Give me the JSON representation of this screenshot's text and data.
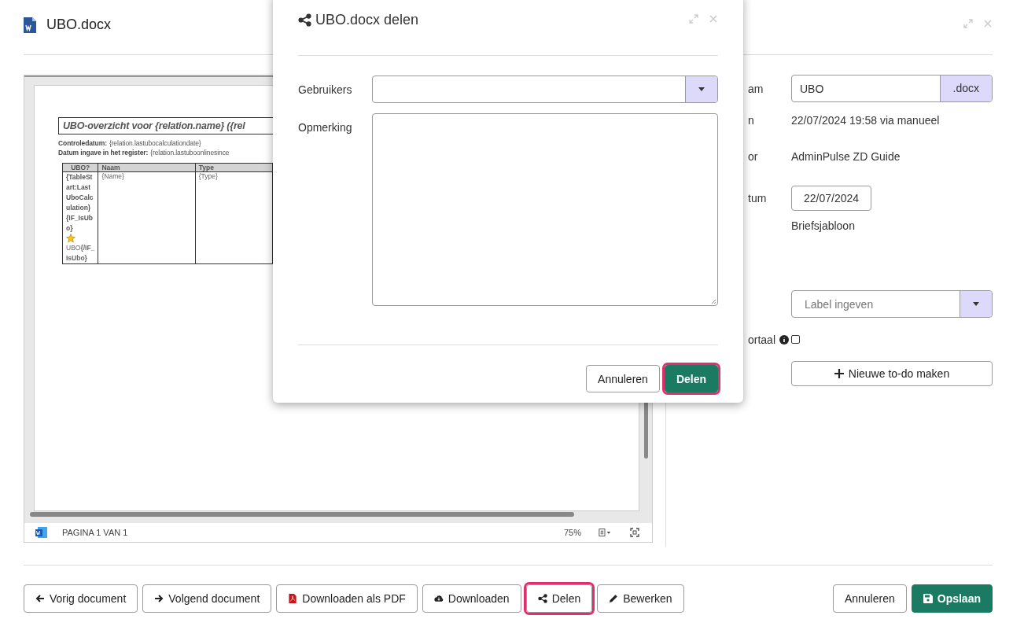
{
  "window": {
    "title": "UBO.docx"
  },
  "document_viewer": {
    "heading": "UBO-overzicht  voor {relation.name}  ({rel",
    "lines": [
      {
        "label": "Controledatum:",
        "value": "{relation.lastubocalculationdate}"
      },
      {
        "label": "Datum ingave in het register:",
        "value": "{relation.lastuboonlinesince"
      }
    ],
    "table": {
      "columns": [
        "UBO?",
        "Naam",
        "Type"
      ],
      "rows": [
        {
          "cells": [
            "{TableStart:LastUboCalculation}{IF_IsUbo}",
            "{Name}",
            "{Type}"
          ],
          "after_icon": "UBO**{/IF_IsUbo}**"
        }
      ]
    },
    "status_bar": {
      "page": "PAGINA 1 VAN 1",
      "zoom": "75%"
    }
  },
  "details": [
    {
      "label": "am",
      "kind": "input",
      "value": "UBO",
      "suffix": ".docx"
    },
    {
      "label": "n",
      "kind": "text",
      "value": "22/07/2024 19:58 via manueel"
    },
    {
      "label": "or",
      "kind": "text",
      "value": "AdminPulse ZD Guide"
    },
    {
      "label": "tum",
      "kind": "date",
      "value": "22/07/2024"
    },
    {
      "kind": "text",
      "value": "Briefsjabloon"
    },
    {
      "kind": "select",
      "placeholder": "Label ingeven"
    },
    {
      "label": "ortaal",
      "kind": "checkbox",
      "checked": false
    },
    {
      "kind": "button",
      "value": "Nieuwe to-do maken"
    }
  ],
  "footer": {
    "left_buttons": [
      {
        "label": "Vorig document",
        "highlighted": false
      },
      {
        "label": "Volgend document",
        "highlighted": false
      },
      {
        "label": "Downloaden als PDF",
        "highlighted": false
      },
      {
        "label": "Downloaden",
        "highlighted": false
      },
      {
        "label": "Delen",
        "highlighted": true
      },
      {
        "label": "Bewerken",
        "highlighted": false
      }
    ],
    "right_buttons": [
      {
        "label": "Annuleren",
        "primary": false
      },
      {
        "label": "Opslaan",
        "primary": true
      }
    ]
  },
  "dialog": {
    "title": "UBO.docx delen",
    "fields": [
      {
        "label": "Gebruikers",
        "kind": "select"
      },
      {
        "label": "Opmerking",
        "kind": "textarea"
      }
    ],
    "buttons": [
      {
        "label": "Annuleren",
        "primary": false,
        "highlighted": false
      },
      {
        "label": "Delen",
        "primary": true,
        "highlighted": true
      }
    ]
  }
}
